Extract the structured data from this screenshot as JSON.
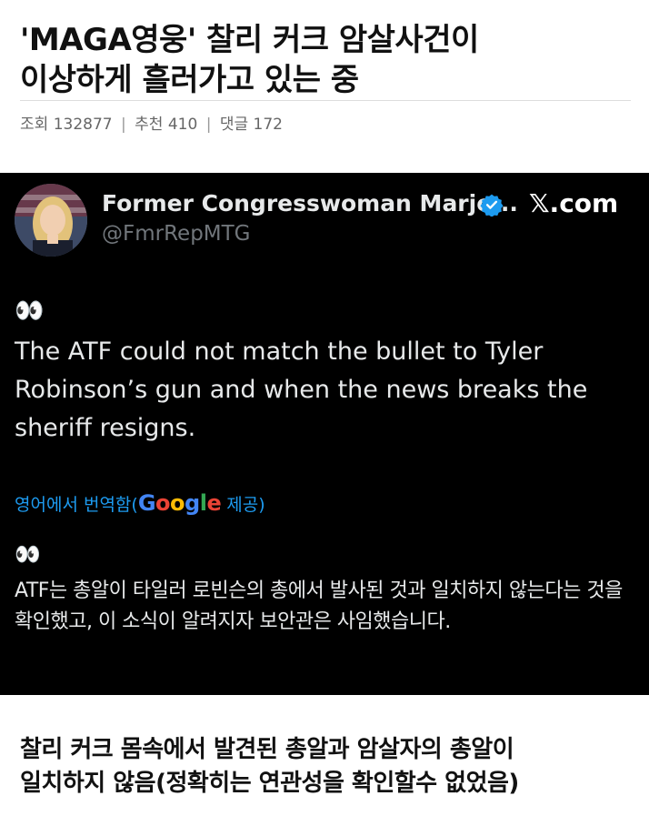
{
  "post": {
    "title_line1": "'MAGA영웅' 찰리 커크 암살사건이",
    "title_line2": "이상하게 흘러가고 있는 중",
    "meta": {
      "views_label": "조회",
      "views": "132877",
      "recommend_label": "추천",
      "recommend": "410",
      "comments_label": "댓글",
      "comments": "172",
      "separator": "|"
    },
    "caption_line1": "찰리 커크 몸속에서 발견된 총알과 암살자의 총알이",
    "caption_line2": "일치하지 않음(정확히는 연관성을 확인할수 없었음)"
  },
  "tweet": {
    "author_name": "Former Congresswoman Marjo...",
    "handle": "@FmrRepMTG",
    "site_label": "𝕏.com",
    "eyes": "👀",
    "text": "The ATF could not match the bullet to Tyler Robinson’s gun and when the news breaks the sheriff resigns.",
    "translate_prefix": "영어에서 번역함(",
    "translate_suffix": " 제공)",
    "google_letters": [
      "G",
      "o",
      "o",
      "g",
      "l",
      "e"
    ],
    "translated_text": "ATF는 총알이 타일러 로빈슨의 총에서 발사된 것과 일치하지 않는다는 것을 확인했고, 이 소식이 알려지자 보안관은 사임했습니다.",
    "icons": {
      "verified": "verified-badge-icon",
      "avatar": "avatar"
    },
    "colors": {
      "background": "#000000",
      "link": "#1d9bf0",
      "verified": "#1d9bf0",
      "handle": "#71767b"
    }
  }
}
